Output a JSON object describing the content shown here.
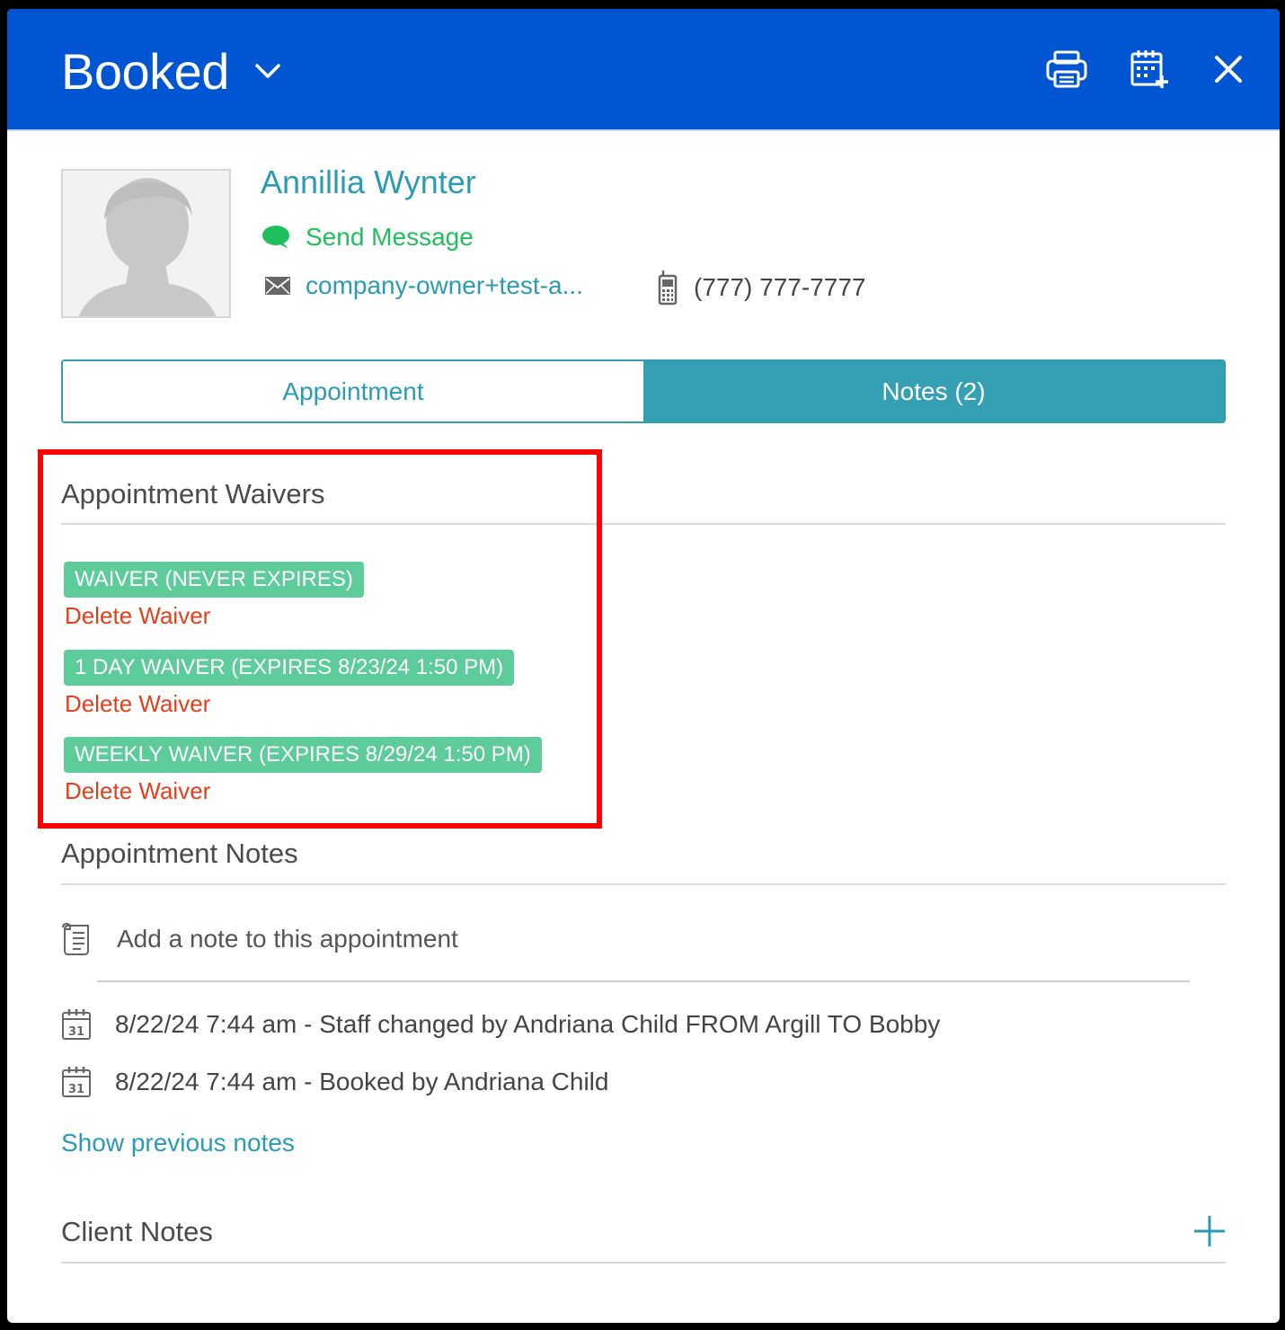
{
  "header": {
    "status": "Booked",
    "icons": [
      "print-icon",
      "calendar-add-icon",
      "close-icon"
    ]
  },
  "client": {
    "name": "Annillia Wynter",
    "send_message": "Send Message",
    "email": "company-owner+test-a...",
    "phone": "(777) 777-7777"
  },
  "tabs": [
    {
      "label": "Appointment",
      "active": false
    },
    {
      "label": "Notes (2)",
      "active": true
    }
  ],
  "waivers": {
    "title": "Appointment Waivers",
    "items": [
      {
        "label": "WAIVER (NEVER EXPIRES)",
        "action": "Delete Waiver"
      },
      {
        "label": "1 DAY WAIVER (EXPIRES 8/23/24 1:50 PM)",
        "action": "Delete Waiver"
      },
      {
        "label": "WEEKLY WAIVER (EXPIRES 8/29/24 1:50 PM)",
        "action": "Delete Waiver"
      }
    ]
  },
  "appointment_notes": {
    "title": "Appointment Notes",
    "add_placeholder": "Add a note to this appointment",
    "entries": [
      "8/22/24 7:44 am - Staff changed by Andriana Child FROM Argill TO Bobby",
      "8/22/24 7:44 am - Booked by Andriana Child"
    ],
    "show_previous": "Show previous notes"
  },
  "client_notes": {
    "title": "Client Notes"
  },
  "colors": {
    "header_bg": "#0056d2",
    "accent": "#2b9bb4",
    "badge": "#5dcb9a",
    "delete": "#e0401d",
    "message": "#1fbf5e",
    "highlight": "#ff0000"
  }
}
